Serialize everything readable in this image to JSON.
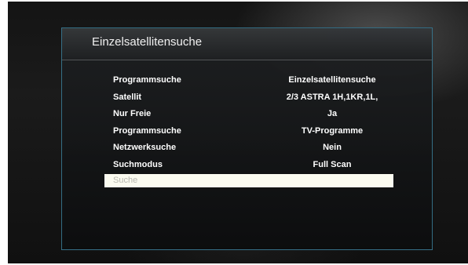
{
  "osd": {
    "title": "Einzelsatellitensuche",
    "rows": [
      {
        "label": "Programmsuche",
        "value": "Einzelsatellitensuche"
      },
      {
        "label": "Satellit",
        "value": "2/3 ASTRA 1H,1KR,1L,"
      },
      {
        "label": "Nur Freie",
        "value": "Ja"
      },
      {
        "label": "Programmsuche",
        "value": "TV-Programme"
      },
      {
        "label": "Netzwerksuche",
        "value": "Nein"
      },
      {
        "label": "Suchmodus",
        "value": "Full Scan"
      }
    ],
    "action": {
      "label": "Suche"
    }
  },
  "colors": {
    "panel_border": "#408caa",
    "highlight": "#fbfbf0",
    "text": "#ffffff"
  }
}
